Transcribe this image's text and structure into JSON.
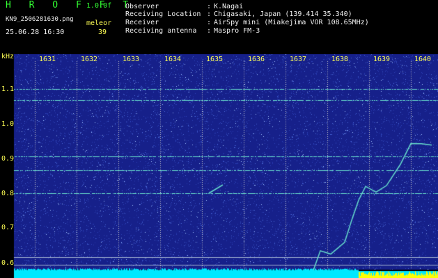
{
  "header": {
    "brand": "H R O F F T",
    "version": "1.0.0f",
    "filename": "KN9_2506281630.png",
    "meteor_label": "meleor",
    "datetime": "25.06.28 16:30",
    "meteor_count": "39",
    "info": [
      {
        "label": "Observer",
        "sep": ":",
        "value": "K.Nagai"
      },
      {
        "label": "Receiving Location",
        "sep": ":",
        "value": "Chigasaki, Japan (139.414 35.340)"
      },
      {
        "label": "Receiver",
        "sep": ":",
        "value": "AirSpy mini (Miakejima VOR 108.65MHz)"
      },
      {
        "label": "Receiving antenna",
        "sep": ":",
        "value": "Maspro FM-3"
      }
    ]
  },
  "plot": {
    "y_unit": "kHz",
    "y_ticks": [
      "1.1",
      "1.0",
      "0.9",
      "0.8",
      "0.7",
      "0.6"
    ],
    "x_ticks": [
      "1631",
      "1632",
      "1633",
      "1634",
      "1635",
      "1636",
      "1637",
      "1638",
      "1639",
      "1640"
    ],
    "colors": {
      "background": "#000000",
      "waterfall_base": "#16208a",
      "noise": "#4a6ad8",
      "signal": "#66ddcc",
      "grid": "#c8c8c8",
      "text_primary": "#33ff33",
      "text_secondary": "#f0f0f0",
      "text_axis": "#ffff55",
      "spectrum_bar": "#00e8ff",
      "spectrum_peak": "#ffff00"
    }
  }
}
